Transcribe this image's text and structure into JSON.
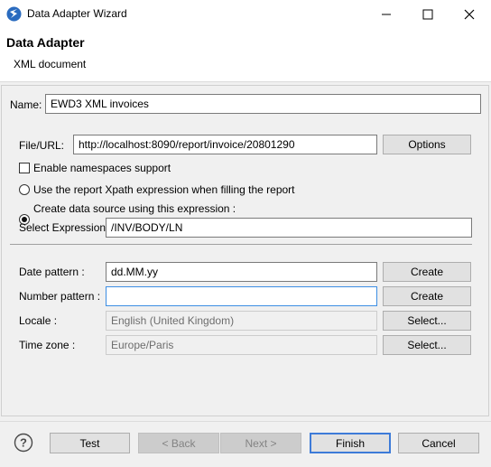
{
  "window": {
    "title": "Data Adapter Wizard",
    "controls": {
      "minimize": "—",
      "maximize": "☐",
      "close": "✕"
    }
  },
  "header": {
    "title": "Data Adapter",
    "subtitle": "XML document"
  },
  "form": {
    "name_label": "Name:",
    "name_value": "EWD3 XML invoices",
    "file_url_label": "File/URL:",
    "file_url_value": "http://localhost:8090/report/invoice/20801290",
    "options_label": "Options",
    "namespaces_label": "Enable namespaces support",
    "namespaces_checked": false,
    "radio_xpath_label": "Use the report Xpath expression when filling the report",
    "radio_create_label": "Create data source using this expression :",
    "selected_mode": "create",
    "select_expr_label": "Select Expression :",
    "select_expr_value": "/INV/BODY/LN",
    "date_pattern_label": "Date pattern :",
    "date_pattern_value": "dd.MM.yy",
    "date_create_label": "Create",
    "number_pattern_label": "Number pattern :",
    "number_pattern_value": "",
    "number_create_label": "Create",
    "locale_label": "Locale :",
    "locale_value": "English (United Kingdom)",
    "locale_select_label": "Select...",
    "timezone_label": "Time zone :",
    "timezone_value": "Europe/Paris",
    "timezone_select_label": "Select..."
  },
  "footer": {
    "help_icon": "?",
    "test_label": "Test",
    "back_label": "< Back",
    "next_label": "Next >",
    "finish_label": "Finish",
    "cancel_label": "Cancel"
  },
  "colors": {
    "accent": "#3d7bd8",
    "focus": "#3d8ee3",
    "app_icon": "#2a6bbf"
  }
}
